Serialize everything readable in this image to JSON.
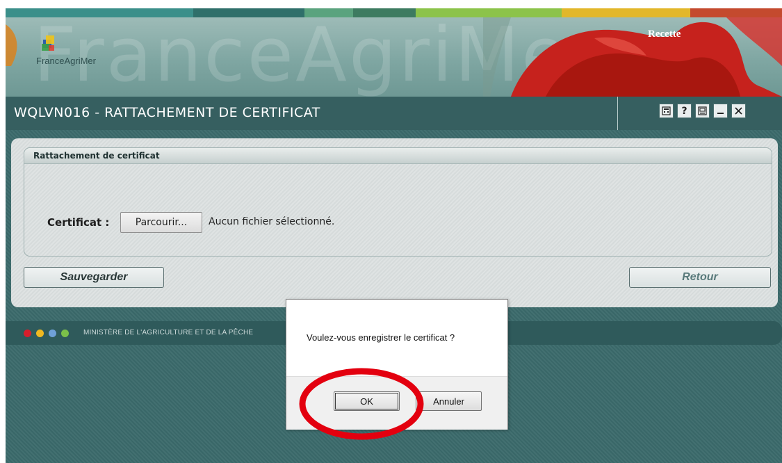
{
  "banner": {
    "watermark": "FranceAgriMer",
    "brand_name": "FranceAgriMer",
    "environment": "Recette"
  },
  "window": {
    "title": "WQLVN016 - RATTACHEMENT DE CERTIFICAT",
    "icons": [
      "calculator-icon",
      "help-icon",
      "print-icon",
      "minimize-icon",
      "close-icon"
    ],
    "help_glyph": "?"
  },
  "form": {
    "section_title": "Rattachement de certificat",
    "certificate_label": "Certificat :",
    "browse_label": "Parcourir...",
    "file_status": "Aucun fichier sélectionné.",
    "save_label": "Sauvegarder",
    "back_label": "Retour"
  },
  "footer": {
    "ministry": "MINISTÈRE DE L'AGRICULTURE ET DE LA PÊCHE",
    "dot_colors": [
      "#d81e2c",
      "#f0b820",
      "#6fa0d8",
      "#7cc04a"
    ]
  },
  "dialog": {
    "message": "Voulez-vous enregistrer le certificat ?",
    "ok_label": "OK",
    "cancel_label": "Annuler"
  },
  "colors": {
    "stripes": [
      "#3b8f8a",
      "#2f6f6a",
      "#5aa37e",
      "#3d7b60",
      "#8cc34a",
      "#e2b72a",
      "#c44a2e"
    ],
    "highlight": "#e3000f"
  }
}
